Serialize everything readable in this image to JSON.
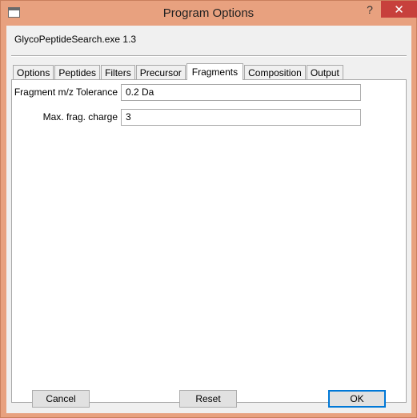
{
  "window": {
    "title": "Program Options",
    "help_glyph": "?",
    "close_glyph": "✕"
  },
  "header": {
    "version_text": "GlycoPeptideSearch.exe 1.3"
  },
  "tabs": [
    {
      "label": "Options"
    },
    {
      "label": "Peptides"
    },
    {
      "label": "Filters"
    },
    {
      "label": "Precursor"
    },
    {
      "label": "Fragments"
    },
    {
      "label": "Composition"
    },
    {
      "label": "Output"
    }
  ],
  "active_tab": "Fragments",
  "fragments": {
    "tolerance_label": "Fragment m/z Tolerance",
    "tolerance_value": "0.2 Da",
    "charge_label": "Max. frag. charge",
    "charge_value": "3"
  },
  "buttons": {
    "cancel": "Cancel",
    "reset": "Reset",
    "ok": "OK"
  },
  "colors": {
    "window_frame": "#e8a17f",
    "close_button": "#c7403c",
    "default_button_border": "#0078d7"
  }
}
